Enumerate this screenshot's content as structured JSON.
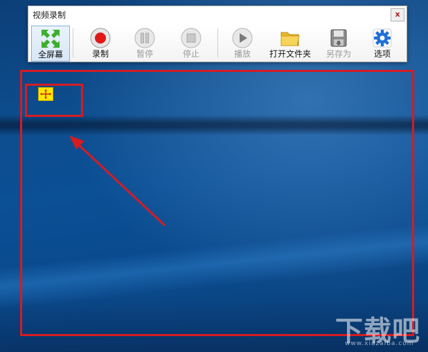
{
  "window": {
    "title": "视频录制",
    "close_symbol": "x"
  },
  "toolbar": {
    "items": [
      {
        "label": "全屏幕",
        "icon": "fullscreen-arrows-icon",
        "enabled": true,
        "active": true
      },
      {
        "label": "录制",
        "icon": "record-icon",
        "enabled": true
      },
      {
        "label": "暂停",
        "icon": "pause-icon",
        "enabled": false
      },
      {
        "label": "停止",
        "icon": "stop-icon",
        "enabled": false
      },
      {
        "label": "播放",
        "icon": "play-icon",
        "enabled": false
      },
      {
        "label": "打开文件夹",
        "icon": "folder-icon",
        "enabled": true
      },
      {
        "label": "另存为",
        "icon": "save-as-icon",
        "enabled": false
      },
      {
        "label": "选项",
        "icon": "gear-icon",
        "enabled": true
      }
    ]
  },
  "annotations": {
    "frame_color": "#d71b22",
    "arrow_color": "#d71b22"
  },
  "watermark": {
    "text": "下载吧",
    "sub": "www.xiazaiba.com"
  },
  "colors": {
    "desktop": "#0b4f94",
    "record": "#e01818",
    "gear": "#2070d8",
    "folder": "#f0c030"
  }
}
